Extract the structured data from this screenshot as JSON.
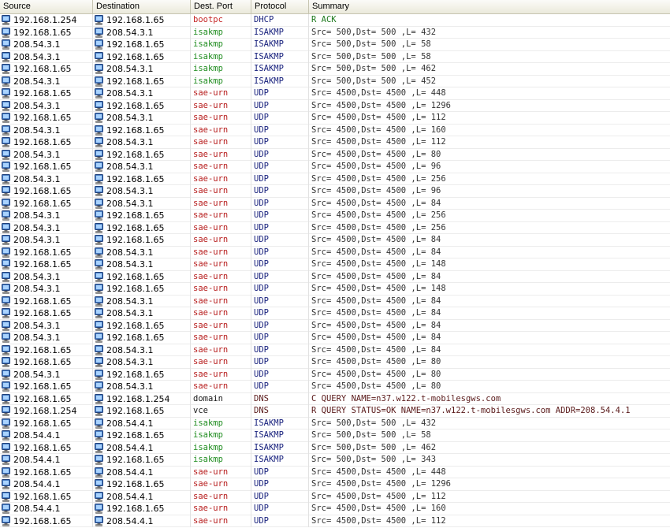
{
  "columns": [
    "Source",
    "Destination",
    "Dest. Port",
    "Protocol",
    "Summary"
  ],
  "colors": {
    "bootpc": "#c62828",
    "isakmp": "#1e8c1e",
    "sae-urn": "#b71c1c",
    "domain": "#1a1a1a",
    "vce": "#1a1a1a",
    "DHCP": "#1a237e",
    "ISAKMP": "#1a237e",
    "UDP": "#1a237e",
    "DNS": "#5a1a1a",
    "summary_default": "#333333",
    "summary_dhcp": "#1e7a1e",
    "summary_dns": "#5a1a1a"
  },
  "rows": [
    [
      "192.168.1.254",
      "192.168.1.65",
      "bootpc",
      "DHCP",
      "R ACK"
    ],
    [
      "192.168.1.65",
      "208.54.3.1",
      "isakmp",
      "ISAKMP",
      "Src=  500,Dst=  500 ,L=  432"
    ],
    [
      "208.54.3.1",
      "192.168.1.65",
      "isakmp",
      "ISAKMP",
      "Src=  500,Dst=  500 ,L=   58"
    ],
    [
      "208.54.3.1",
      "192.168.1.65",
      "isakmp",
      "ISAKMP",
      "Src=  500,Dst=  500 ,L=   58"
    ],
    [
      "192.168.1.65",
      "208.54.3.1",
      "isakmp",
      "ISAKMP",
      "Src=  500,Dst=  500 ,L=  462"
    ],
    [
      "208.54.3.1",
      "192.168.1.65",
      "isakmp",
      "ISAKMP",
      "Src=  500,Dst=  500 ,L=  452"
    ],
    [
      "192.168.1.65",
      "208.54.3.1",
      "sae-urn",
      "UDP",
      "Src= 4500,Dst= 4500 ,L=  448"
    ],
    [
      "208.54.3.1",
      "192.168.1.65",
      "sae-urn",
      "UDP",
      "Src= 4500,Dst= 4500 ,L= 1296"
    ],
    [
      "192.168.1.65",
      "208.54.3.1",
      "sae-urn",
      "UDP",
      "Src= 4500,Dst= 4500 ,L=  112"
    ],
    [
      "208.54.3.1",
      "192.168.1.65",
      "sae-urn",
      "UDP",
      "Src= 4500,Dst= 4500 ,L=  160"
    ],
    [
      "192.168.1.65",
      "208.54.3.1",
      "sae-urn",
      "UDP",
      "Src= 4500,Dst= 4500 ,L=  112"
    ],
    [
      "208.54.3.1",
      "192.168.1.65",
      "sae-urn",
      "UDP",
      "Src= 4500,Dst= 4500 ,L=   80"
    ],
    [
      "192.168.1.65",
      "208.54.3.1",
      "sae-urn",
      "UDP",
      "Src= 4500,Dst= 4500 ,L=   96"
    ],
    [
      "208.54.3.1",
      "192.168.1.65",
      "sae-urn",
      "UDP",
      "Src= 4500,Dst= 4500 ,L=  256"
    ],
    [
      "192.168.1.65",
      "208.54.3.1",
      "sae-urn",
      "UDP",
      "Src= 4500,Dst= 4500 ,L=   96"
    ],
    [
      "192.168.1.65",
      "208.54.3.1",
      "sae-urn",
      "UDP",
      "Src= 4500,Dst= 4500 ,L=   84"
    ],
    [
      "208.54.3.1",
      "192.168.1.65",
      "sae-urn",
      "UDP",
      "Src= 4500,Dst= 4500 ,L=  256"
    ],
    [
      "208.54.3.1",
      "192.168.1.65",
      "sae-urn",
      "UDP",
      "Src= 4500,Dst= 4500 ,L=  256"
    ],
    [
      "208.54.3.1",
      "192.168.1.65",
      "sae-urn",
      "UDP",
      "Src= 4500,Dst= 4500 ,L=   84"
    ],
    [
      "192.168.1.65",
      "208.54.3.1",
      "sae-urn",
      "UDP",
      "Src= 4500,Dst= 4500 ,L=   84"
    ],
    [
      "192.168.1.65",
      "208.54.3.1",
      "sae-urn",
      "UDP",
      "Src= 4500,Dst= 4500 ,L=  148"
    ],
    [
      "208.54.3.1",
      "192.168.1.65",
      "sae-urn",
      "UDP",
      "Src= 4500,Dst= 4500 ,L=   84"
    ],
    [
      "208.54.3.1",
      "192.168.1.65",
      "sae-urn",
      "UDP",
      "Src= 4500,Dst= 4500 ,L=  148"
    ],
    [
      "192.168.1.65",
      "208.54.3.1",
      "sae-urn",
      "UDP",
      "Src= 4500,Dst= 4500 ,L=   84"
    ],
    [
      "192.168.1.65",
      "208.54.3.1",
      "sae-urn",
      "UDP",
      "Src= 4500,Dst= 4500 ,L=   84"
    ],
    [
      "208.54.3.1",
      "192.168.1.65",
      "sae-urn",
      "UDP",
      "Src= 4500,Dst= 4500 ,L=   84"
    ],
    [
      "208.54.3.1",
      "192.168.1.65",
      "sae-urn",
      "UDP",
      "Src= 4500,Dst= 4500 ,L=   84"
    ],
    [
      "192.168.1.65",
      "208.54.3.1",
      "sae-urn",
      "UDP",
      "Src= 4500,Dst= 4500 ,L=   84"
    ],
    [
      "192.168.1.65",
      "208.54.3.1",
      "sae-urn",
      "UDP",
      "Src= 4500,Dst= 4500 ,L=   80"
    ],
    [
      "208.54.3.1",
      "192.168.1.65",
      "sae-urn",
      "UDP",
      "Src= 4500,Dst= 4500 ,L=   80"
    ],
    [
      "192.168.1.65",
      "208.54.3.1",
      "sae-urn",
      "UDP",
      "Src= 4500,Dst= 4500 ,L=   80"
    ],
    [
      "192.168.1.65",
      "192.168.1.254",
      "domain",
      "DNS",
      "C QUERY NAME=n37.w122.t-mobilesgws.com"
    ],
    [
      "192.168.1.254",
      "192.168.1.65",
      "vce",
      "DNS",
      "R QUERY STATUS=OK NAME=n37.w122.t-mobilesgws.com ADDR=208.54.4.1"
    ],
    [
      "192.168.1.65",
      "208.54.4.1",
      "isakmp",
      "ISAKMP",
      "Src=  500,Dst=  500 ,L=  432"
    ],
    [
      "208.54.4.1",
      "192.168.1.65",
      "isakmp",
      "ISAKMP",
      "Src=  500,Dst=  500 ,L=   58"
    ],
    [
      "192.168.1.65",
      "208.54.4.1",
      "isakmp",
      "ISAKMP",
      "Src=  500,Dst=  500 ,L=  462"
    ],
    [
      "208.54.4.1",
      "192.168.1.65",
      "isakmp",
      "ISAKMP",
      "Src=  500,Dst=  500 ,L=  343"
    ],
    [
      "192.168.1.65",
      "208.54.4.1",
      "sae-urn",
      "UDP",
      "Src= 4500,Dst= 4500 ,L=  448"
    ],
    [
      "208.54.4.1",
      "192.168.1.65",
      "sae-urn",
      "UDP",
      "Src= 4500,Dst= 4500 ,L= 1296"
    ],
    [
      "192.168.1.65",
      "208.54.4.1",
      "sae-urn",
      "UDP",
      "Src= 4500,Dst= 4500 ,L=  112"
    ],
    [
      "208.54.4.1",
      "192.168.1.65",
      "sae-urn",
      "UDP",
      "Src= 4500,Dst= 4500 ,L=  160"
    ],
    [
      "192.168.1.65",
      "208.54.4.1",
      "sae-urn",
      "UDP",
      "Src= 4500,Dst= 4500 ,L=  112"
    ]
  ]
}
